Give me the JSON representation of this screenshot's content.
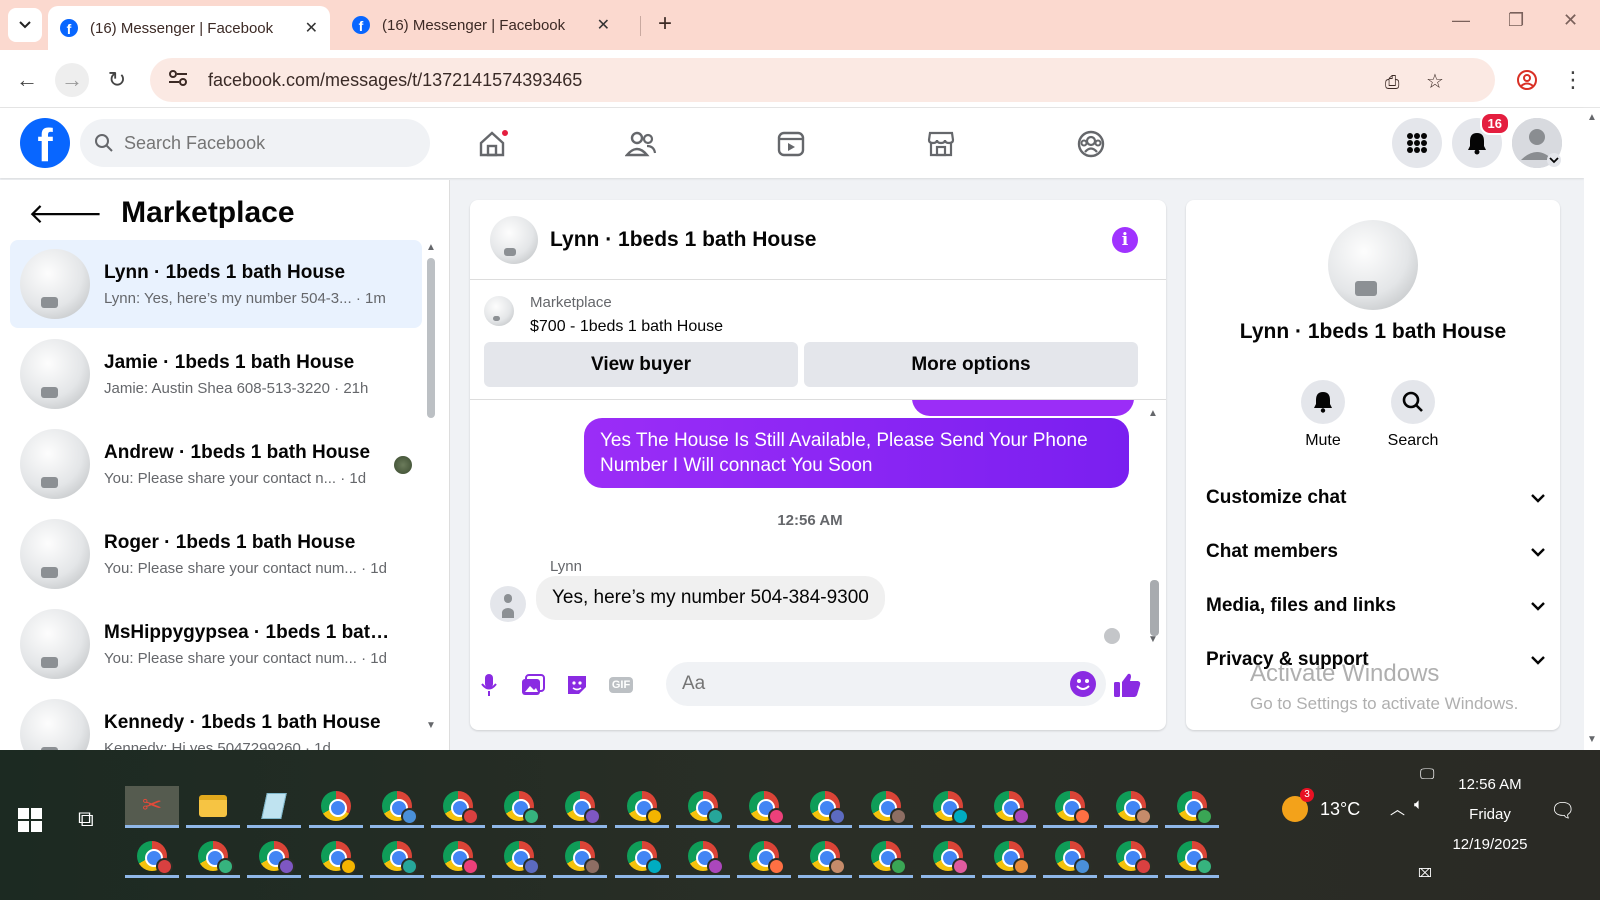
{
  "browser": {
    "tabs": [
      {
        "title": "(16) Messenger | Facebook",
        "active": true
      },
      {
        "title": "(16) Messenger | Facebook",
        "active": false
      }
    ],
    "url": "facebook.com/messages/t/1372141574393465"
  },
  "header": {
    "search_placeholder": "Search Facebook",
    "notification_count": "16"
  },
  "sidebar": {
    "title": "Marketplace",
    "conversations": [
      {
        "name": "Lynn · 1beds 1 bath House",
        "preview": "Lynn: Yes, here’s my number 504-3... · 1m",
        "selected": true
      },
      {
        "name": "Jamie · 1beds 1 bath House",
        "preview": "Jamie: Austin Shea 608-513-3220 · 21h"
      },
      {
        "name": "Andrew · 1beds 1 bath House",
        "preview": "You: Please share your contact n... · 1d"
      },
      {
        "name": "Roger · 1beds 1 bath House",
        "preview": "You: Please share your contact num... · 1d"
      },
      {
        "name": "MsHippygypsea · 1beds 1 bath H...",
        "preview": "You: Please share your contact num... · 1d"
      },
      {
        "name": "Kennedy · 1beds 1 bath House",
        "preview": "Kennedy: Hi yes 5047299260 · 1d"
      }
    ]
  },
  "chat": {
    "title": "Lynn · 1beds 1 bath House",
    "listing_label": "Marketplace",
    "listing_title": "$700 - 1beds 1 bath House",
    "view_buyer": "View buyer",
    "more_options": "More options",
    "outgoing_message": "Yes The House Is Still Available, Please Send Your Phone Number I Will connact You Soon",
    "timestamp": "12:56 AM",
    "sender": "Lynn",
    "incoming_message": "Yes, here’s my number 504-384-9300",
    "composer_placeholder": "Aa"
  },
  "info_panel": {
    "name": "Lynn · 1beds 1 bath House",
    "mute": "Mute",
    "search": "Search",
    "sections": [
      "Customize chat",
      "Chat members",
      "Media, files and links",
      "Privacy & support"
    ]
  },
  "watermark": {
    "line1": "Activate Windows",
    "line2": "Go to Settings to activate Windows."
  },
  "taskbar": {
    "temperature": "13°C",
    "weather_badge": "3",
    "time": "12:56 AM",
    "day": "Friday",
    "date": "12/19/2025"
  },
  "colors": {
    "facebook_blue": "#0866ff",
    "messenger_purple": "#9b2df7",
    "notification_red": "#e41e3f"
  }
}
